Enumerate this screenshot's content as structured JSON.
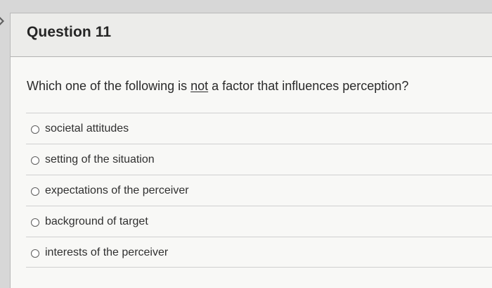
{
  "question": {
    "title": "Question 11",
    "prompt_before": "Which one of the following is ",
    "prompt_emphasis": "not",
    "prompt_after": " a factor that influences perception?",
    "options": [
      "societal attitudes",
      "setting of the situation",
      "expectations of the perceiver",
      "background of target",
      "interests of the perceiver"
    ]
  }
}
